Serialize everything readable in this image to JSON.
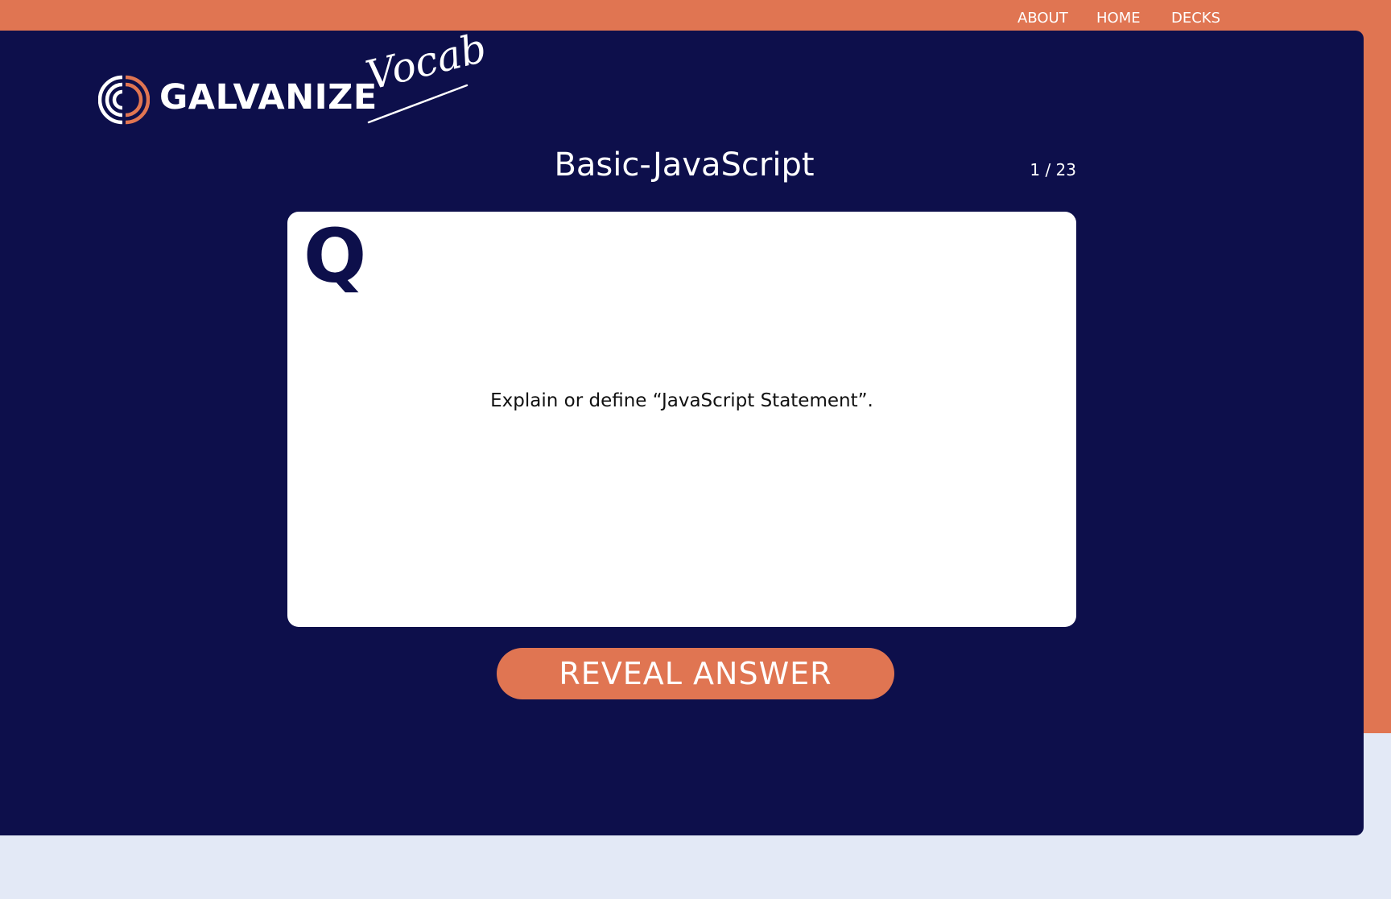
{
  "colors": {
    "accent": "#e07552",
    "navy": "#0d0f4b",
    "page_background": "#e3e9f6",
    "card": "#ffffff"
  },
  "nav": {
    "about": "ABOUT",
    "home": "HOME",
    "decks": "DECKS"
  },
  "brand": {
    "name": "GALVANIZE",
    "script": "Vocab",
    "logo_icon": "galvanize-circle-logo-icon"
  },
  "deck": {
    "title": "Basic-JavaScript",
    "counter": "1 / 23"
  },
  "card": {
    "marker": "Q",
    "question": "Explain or define “JavaScript Statement”."
  },
  "actions": {
    "reveal": "REVEAL ANSWER"
  }
}
